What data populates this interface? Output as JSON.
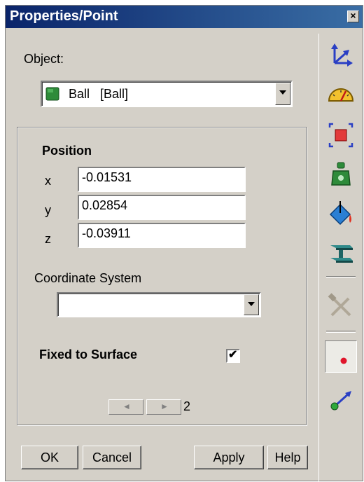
{
  "window": {
    "title": "Properties/Point",
    "close_glyph": "×"
  },
  "object": {
    "label": "Object:",
    "selected": "Ball   [Ball]",
    "icon": "green-cube-icon"
  },
  "position": {
    "heading": "Position",
    "x_label": "x",
    "x_value": "-0.01531",
    "y_label": "y",
    "y_value": "0.02854",
    "z_label": "z",
    "z_value": "-0.03911"
  },
  "coordinate_system": {
    "label": "Coordinate System",
    "selected": ""
  },
  "fixed_to_surface": {
    "label": "Fixed to Surface",
    "checked": true,
    "check_glyph": "✔"
  },
  "pager": {
    "prev_glyph": "◄",
    "next_glyph": "►",
    "page": "2"
  },
  "buttons": {
    "ok": "OK",
    "cancel": "Cancel",
    "apply": "Apply",
    "help": "Help"
  },
  "toolbar": [
    "axes-icon",
    "gauge-icon",
    "bounding-box-icon",
    "mass-icon",
    "paint-bucket-icon",
    "beam-icon",
    "tools-icon",
    "point-icon",
    "vector-icon"
  ],
  "colors": {
    "titlebar": "#0a246a",
    "panel": "#d4d0c8",
    "cube": "#2e8b3a",
    "point": "#e0152b"
  }
}
